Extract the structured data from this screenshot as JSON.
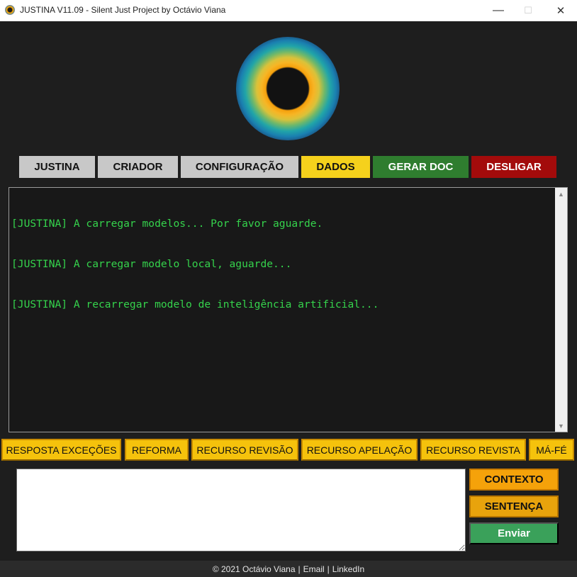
{
  "window": {
    "title": "JUSTINA V11.09 - Silent Just Project by Octávio Viana",
    "minimize": "—",
    "maximize": "☐",
    "close": "✕"
  },
  "icons": {
    "app": "eye-logo-icon",
    "logo": "eye-logo-icon"
  },
  "colors": {
    "console_text": "#35d34c",
    "action_yellow": "#f5c20c",
    "orange": "#f5a20a",
    "send_green": "#3aa15a",
    "shutdown_red": "#a30b0b"
  },
  "toolbar": {
    "justina": "JUSTINA",
    "criador": "CRIADOR",
    "configuracao": "CONFIGURAÇÃO",
    "dados": "DADOS",
    "gerar_doc": "GERAR DOC",
    "desligar": "DESLIGAR"
  },
  "console": {
    "lines": [
      "[JUSTINA] A carregar modelos... Por favor aguarde.",
      "[JUSTINA] A carregar modelo local, aguarde...",
      "[JUSTINA] A recarregar modelo de inteligência artificial..."
    ],
    "scroll_up": "▲",
    "scroll_down": "▼"
  },
  "actions": {
    "resposta_excecoes": "RESPOSTA EXCEÇÕES",
    "reforma": "REFORMA",
    "recurso_revisao": "RECURSO REVISÃO",
    "recurso_apelacao": "RECURSO APELAÇÃO",
    "recurso_revista": "RECURSO REVISTA",
    "ma_fe": "MÁ-FÉ"
  },
  "input": {
    "value": ""
  },
  "side": {
    "contexto": "CONTEXTO",
    "sentenca": "SENTENÇA",
    "enviar": "Enviar"
  },
  "footer": {
    "copyright": "© 2021 Octávio Viana",
    "sep1": "|",
    "email": "Email",
    "sep2": "|",
    "linkedin": "LinkedIn"
  }
}
